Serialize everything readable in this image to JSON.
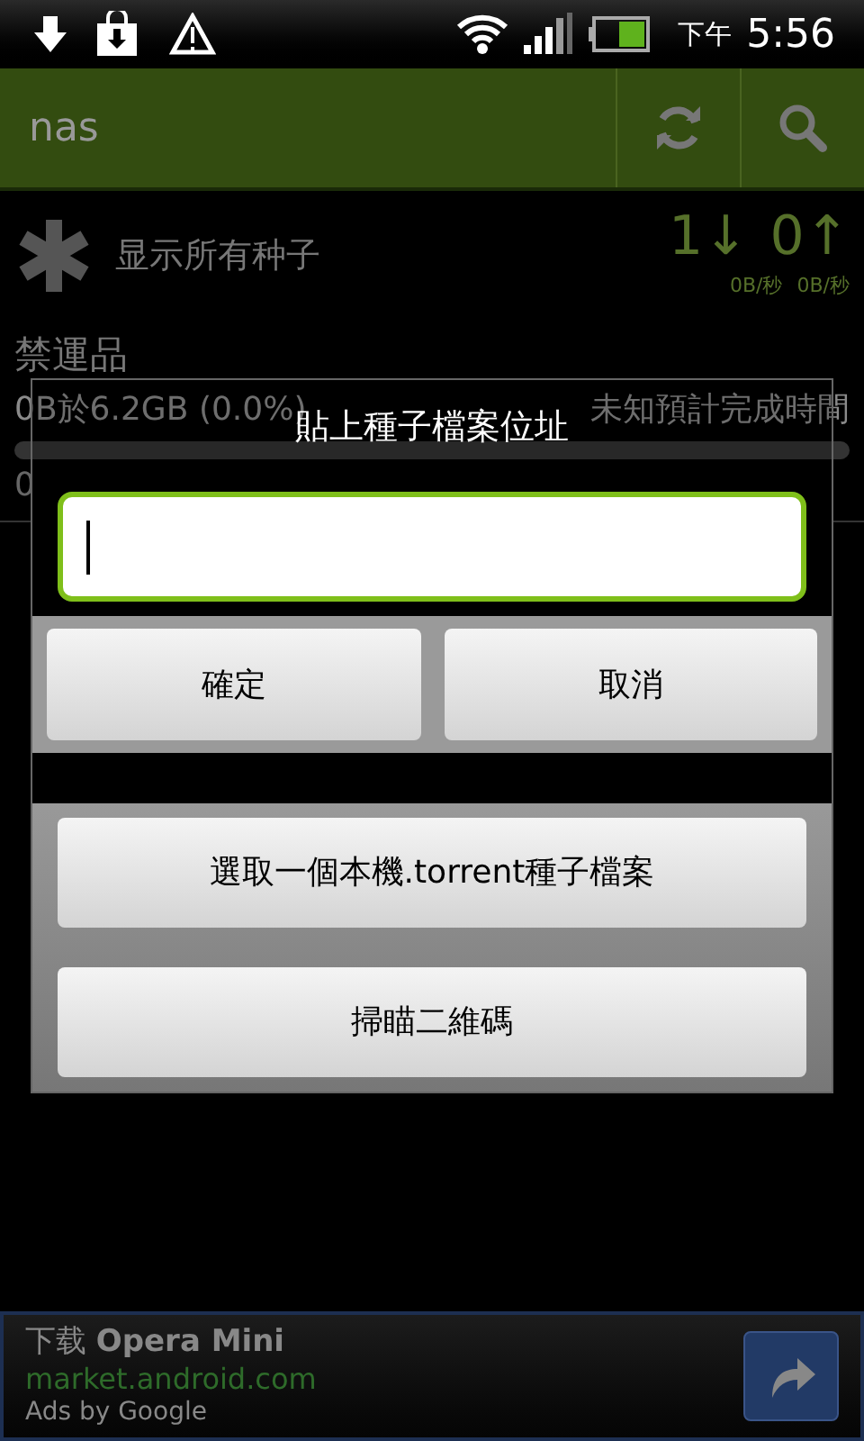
{
  "status_bar": {
    "time_period": "下午",
    "time": "5:56"
  },
  "app_bar": {
    "title": "nas"
  },
  "filter": {
    "label": "显示所有种子",
    "down_count": "1",
    "down_arrow": "↓",
    "up_count": "0",
    "up_arrow": "↑",
    "down_rate": "0B/秒",
    "up_rate": "0B/秒"
  },
  "torrents": [
    {
      "name": "禁運品",
      "progress_text": "0B於6.2GB (0.0%)",
      "eta": "未知預計完成時間",
      "level": 0,
      "peers": "0"
    }
  ],
  "dialog": {
    "title": "貼上種子檔案位址",
    "input": {
      "focused": true
    },
    "buttons": [
      "確定",
      "取消"
    ],
    "actions": [
      "選取一個本機.torrent種子檔案",
      "掃瞄二維碼"
    ]
  },
  "ad": {
    "headline": "下载 **Opera Mini**",
    "url": "market.android.com",
    "attribution": "Ads by Google"
  }
}
